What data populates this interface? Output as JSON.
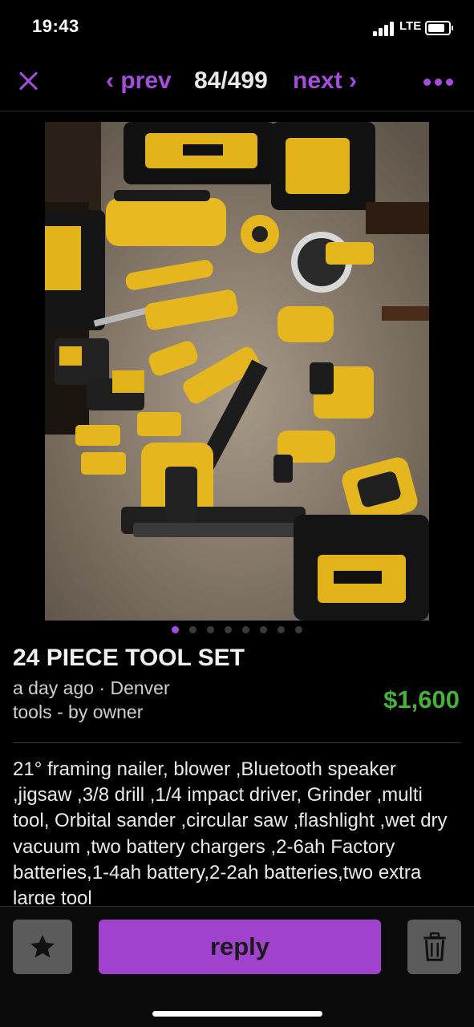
{
  "status_bar": {
    "time": "19:43",
    "network": "LTE"
  },
  "nav": {
    "prev_label": "‹ prev",
    "counter": "84/499",
    "next_label": "next ›"
  },
  "photo": {
    "description_icon": "tool-set-photo",
    "slide_count": 8,
    "active_slide": 1
  },
  "listing": {
    "title": "24 PIECE TOOL SET",
    "posted": "a day ago · Denver",
    "category": "tools - by owner",
    "price": "$1,600",
    "description": "21° framing nailer, blower ,Bluetooth speaker ,jigsaw ,3/8 drill ,1/4 impact driver, Grinder ,multi tool, Orbital sander ,circular saw ,flashlight ,wet dry vacuum ,two battery chargers ,2-6ah Factory batteries,1-4ah battery,2-2ah batteries,two extra large tool"
  },
  "actions": {
    "reply_label": "reply"
  },
  "colors": {
    "accent": "#a64ddc",
    "price": "#48b13b",
    "button_gray": "#5b5b5b",
    "background": "#000000"
  }
}
